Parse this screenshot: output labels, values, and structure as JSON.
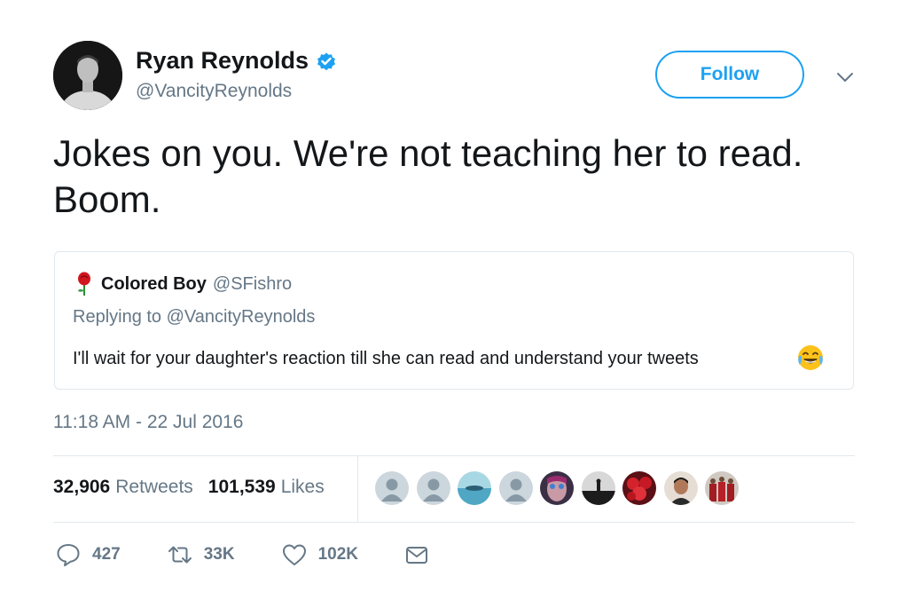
{
  "author": {
    "name": "Ryan Reynolds",
    "handle": "@VancityReynolds",
    "verified_icon": "verified-badge-icon",
    "avatar_icon": "profile-photo"
  },
  "follow_button": {
    "label": "Follow"
  },
  "menu_icon": "chevron-down-icon",
  "tweet": {
    "text": "Jokes on you. We're not teaching her to read. Boom.",
    "timestamp": "11:18 AM - 22 Jul 2016"
  },
  "quoted": {
    "icon": "rose-emoji",
    "name": "Colored Boy",
    "handle": "@SFishro",
    "replying_to": "Replying to @VancityReynolds",
    "text": "I'll wait for your daughter's reaction till she can read and understand your tweets",
    "emoji": "tears-of-joy-emoji"
  },
  "stats": {
    "retweets_count": "32,906",
    "retweets_label": "Retweets",
    "likes_count": "101,539",
    "likes_label": "Likes"
  },
  "likers": [
    {
      "icon": "default-avatar",
      "color": "#aab8c2"
    },
    {
      "icon": "default-avatar",
      "color": "#aab8c2"
    },
    {
      "icon": "water-photo-avatar",
      "color": "#7fc3d6"
    },
    {
      "icon": "default-avatar",
      "color": "#aab8c2"
    },
    {
      "icon": "face-photo-avatar",
      "color": "#5a4a66"
    },
    {
      "icon": "silhouette-photo-avatar",
      "color": "#2b2b2b"
    },
    {
      "icon": "strawberries-photo-avatar",
      "color": "#c0202c"
    },
    {
      "icon": "person-photo-avatar",
      "color": "#4a3a30"
    },
    {
      "icon": "team-photo-avatar",
      "color": "#7a2a2a"
    }
  ],
  "actions": {
    "reply_count": "427",
    "retweet_count": "33K",
    "like_count": "102K"
  },
  "colors": {
    "accent": "#1da1f2",
    "secondary_text": "#657786",
    "border": "#e1e8ed"
  }
}
